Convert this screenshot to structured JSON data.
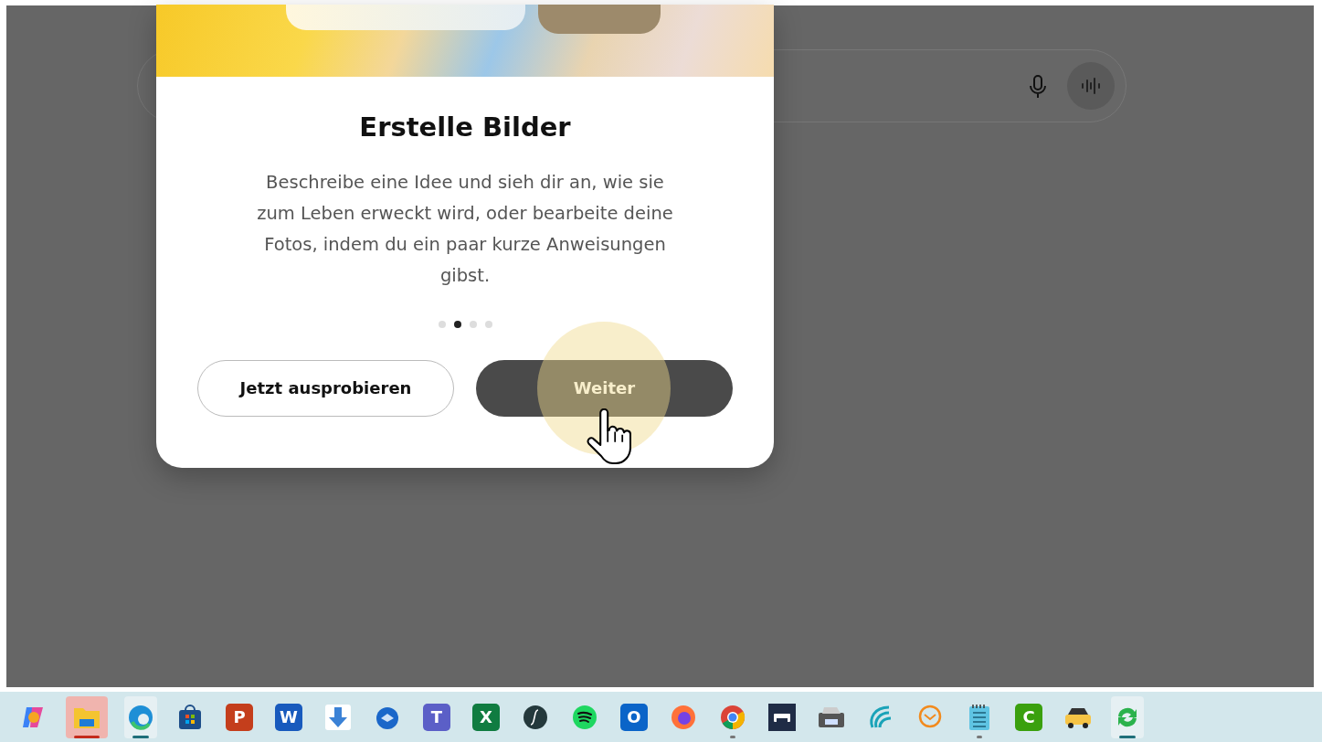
{
  "dialog": {
    "title": "Erstelle Bilder",
    "body": "Beschreibe eine Idee und sieh dir an, wie sie zum Leben erweckt wird, oder bearbeite deine Fotos, indem du ein paar kurze Anweisungen gibst.",
    "pager": [
      {
        "selected": false
      },
      {
        "selected": true
      },
      {
        "selected": false
      },
      {
        "selected": false
      }
    ],
    "buttons": [
      {
        "kind": "outline",
        "label": "Jetzt ausprobieren"
      },
      {
        "kind": "filled",
        "label": "Weiter"
      }
    ]
  },
  "taskbar": [
    {
      "kind": "copilot",
      "open": false,
      "selected": false,
      "attention": false
    },
    {
      "kind": "folder",
      "open": true,
      "selected": false,
      "attention": true
    },
    {
      "kind": "edge",
      "open": true,
      "selected": true,
      "attention": false
    },
    {
      "kind": "store",
      "open": false,
      "selected": false,
      "attention": false
    },
    {
      "kind": "letter",
      "label": "P",
      "color": "#c43e1c",
      "open": false,
      "selected": false,
      "attention": false
    },
    {
      "kind": "letter",
      "label": "W",
      "color": "#185abd",
      "open": false,
      "selected": false,
      "attention": false
    },
    {
      "kind": "download",
      "open": false,
      "selected": false,
      "attention": false
    },
    {
      "kind": "bird",
      "open": false,
      "selected": false,
      "attention": false
    },
    {
      "kind": "letter",
      "label": "T",
      "color": "#5b5fc7",
      "open": false,
      "selected": false,
      "attention": false
    },
    {
      "kind": "letter",
      "label": "X",
      "color": "#107c41",
      "open": false,
      "selected": false,
      "attention": false
    },
    {
      "kind": "note",
      "open": false,
      "selected": false,
      "attention": false
    },
    {
      "kind": "spotify",
      "open": false,
      "selected": false,
      "attention": false
    },
    {
      "kind": "letter",
      "label": "O",
      "color": "#0a64c8",
      "open": false,
      "selected": false,
      "attention": false
    },
    {
      "kind": "firefox",
      "open": false,
      "selected": false,
      "attention": false
    },
    {
      "kind": "chrome",
      "open": true,
      "selected": false,
      "attention": false
    },
    {
      "kind": "printer",
      "open": false,
      "selected": false,
      "attention": false
    },
    {
      "kind": "scanner",
      "open": false,
      "selected": false,
      "attention": false
    },
    {
      "kind": "wave",
      "open": false,
      "selected": false,
      "attention": false
    },
    {
      "kind": "mail",
      "open": false,
      "selected": false,
      "attention": false
    },
    {
      "kind": "notepad",
      "open": true,
      "selected": false,
      "attention": false
    },
    {
      "kind": "letter",
      "label": "C",
      "color": "#3aa00e",
      "open": false,
      "selected": false,
      "attention": false
    },
    {
      "kind": "taxi",
      "open": false,
      "selected": false,
      "attention": false
    },
    {
      "kind": "sync",
      "open": true,
      "selected": true,
      "attention": false
    }
  ]
}
